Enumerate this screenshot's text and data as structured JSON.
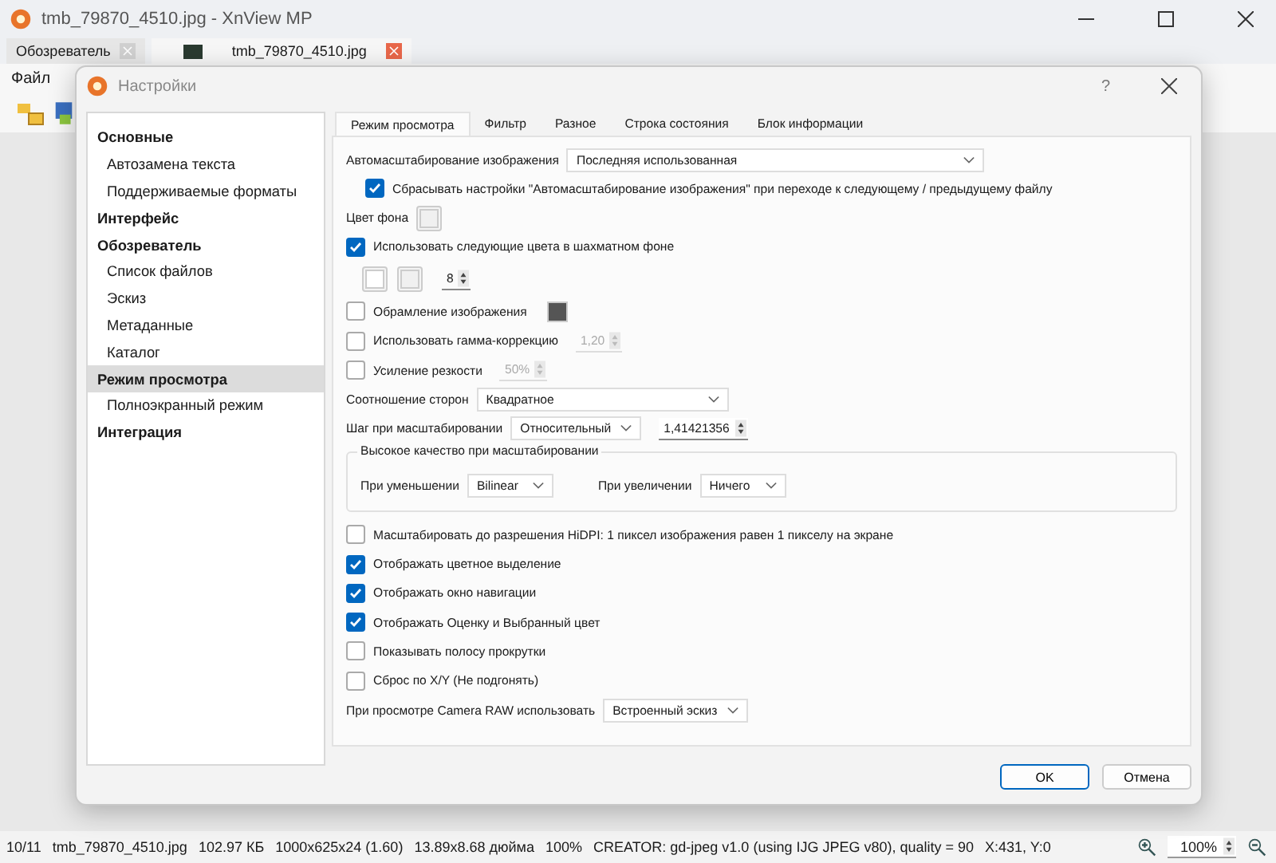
{
  "main_window": {
    "title": "tmb_79870_4510.jpg - XnView MP",
    "tabs": [
      {
        "label": "Обозреватель",
        "selected": false
      },
      {
        "label": "tmb_79870_4510.jpg",
        "selected": true
      }
    ],
    "menu": [
      "Файл"
    ]
  },
  "dialog": {
    "title": "Настройки",
    "help": "?",
    "sidebar": [
      {
        "label": "Основные",
        "selected": false,
        "children": [
          {
            "label": "Автозамена текста",
            "selected": false
          },
          {
            "label": "Поддерживаемые форматы",
            "selected": false
          }
        ]
      },
      {
        "label": "Интерфейс",
        "selected": false
      },
      {
        "label": "Обозреватель",
        "selected": false,
        "children": [
          {
            "label": "Список файлов",
            "selected": false
          },
          {
            "label": "Эскиз",
            "selected": false
          },
          {
            "label": "Метаданные",
            "selected": false
          },
          {
            "label": "Каталог",
            "selected": false
          }
        ]
      },
      {
        "label": "Режим просмотра",
        "selected": true,
        "children": [
          {
            "label": "Полноэкранный режим",
            "selected": false
          }
        ]
      },
      {
        "label": "Интеграция",
        "selected": false
      }
    ],
    "tabs": [
      {
        "label": "Режим просмотра",
        "selected": true
      },
      {
        "label": "Фильтр",
        "selected": false
      },
      {
        "label": "Разное",
        "selected": false
      },
      {
        "label": "Строка состояния",
        "selected": false
      },
      {
        "label": "Блок информации",
        "selected": false
      }
    ],
    "settings": [
      {
        "kind": "select",
        "label": "Автомасштабирование изображения",
        "value": "Последняя использованная"
      },
      {
        "kind": "subcheckbox",
        "label": "Сбрасывать настройки \"Автомасштабирование изображения\" при переходе к следующему / предыдущему файлу",
        "checked": true
      },
      {
        "kind": "color",
        "label": "Цвет фона"
      },
      {
        "kind": "checkbox",
        "label": "Использовать следующие цвета в шахматном фоне",
        "checked": true
      },
      {
        "kind": "swatches",
        "spin": {
          "value": "8",
          "disabled": false
        }
      },
      {
        "kind": "checkbox",
        "label": "Обрамление изображения",
        "checked": false,
        "swatch": true
      },
      {
        "kind": "checkbox",
        "label": "Использовать гамма-коррекцию",
        "checked": false,
        "spin": {
          "value": "1,20",
          "disabled": true
        }
      },
      {
        "kind": "checkbox",
        "label": "Усиление резкости",
        "checked": false,
        "spin": {
          "value": "50%",
          "disabled": true
        }
      },
      {
        "kind": "select",
        "label": "Соотношение сторон",
        "value": "Квадратное"
      },
      {
        "kind": "select",
        "label": "Шаг при масштабировании",
        "value": "Относительный",
        "spin": {
          "value": "1,41421356",
          "disabled": false
        }
      },
      {
        "kind": "group",
        "title": "Высокое качество при масштабировании",
        "selects": [
          {
            "label": "При уменьшении",
            "value": "Bilinear"
          },
          {
            "label": "При увеличении",
            "value": "Ничего"
          }
        ]
      },
      {
        "kind": "checkbox",
        "label": "Масштабировать до разрешения HiDPI: 1 пиксел изображения равен 1 пикселу на экране",
        "checked": false
      },
      {
        "kind": "checkbox",
        "label": "Отображать цветное выделение",
        "checked": true
      },
      {
        "kind": "checkbox",
        "label": "Отображать окно навигации",
        "checked": true
      },
      {
        "kind": "checkbox",
        "label": "Отображать Оценку и Выбранный цвет",
        "checked": true
      },
      {
        "kind": "checkbox",
        "label": "Показывать полосу прокрутки",
        "checked": false
      },
      {
        "kind": "checkbox",
        "label": "Сброс по X/Y (Не подгонять)",
        "checked": false
      },
      {
        "kind": "select",
        "label": "При просмотре Camera RAW использовать",
        "value": "Встроенный эскиз"
      }
    ],
    "buttons": [
      {
        "label": "OK",
        "primary": true
      },
      {
        "label": "Отмена",
        "primary": false
      }
    ]
  },
  "status_bar": {
    "items": [
      "10/11",
      "tmb_79870_4510.jpg",
      "102.97 КБ",
      "1000x625x24 (1.60)",
      "13.89x8.68 дюйма",
      "100%",
      "CREATOR: gd-jpeg v1.0 (using IJG JPEG v80), quality = 90",
      "X:431, Y:0"
    ],
    "zoom": "100%"
  }
}
